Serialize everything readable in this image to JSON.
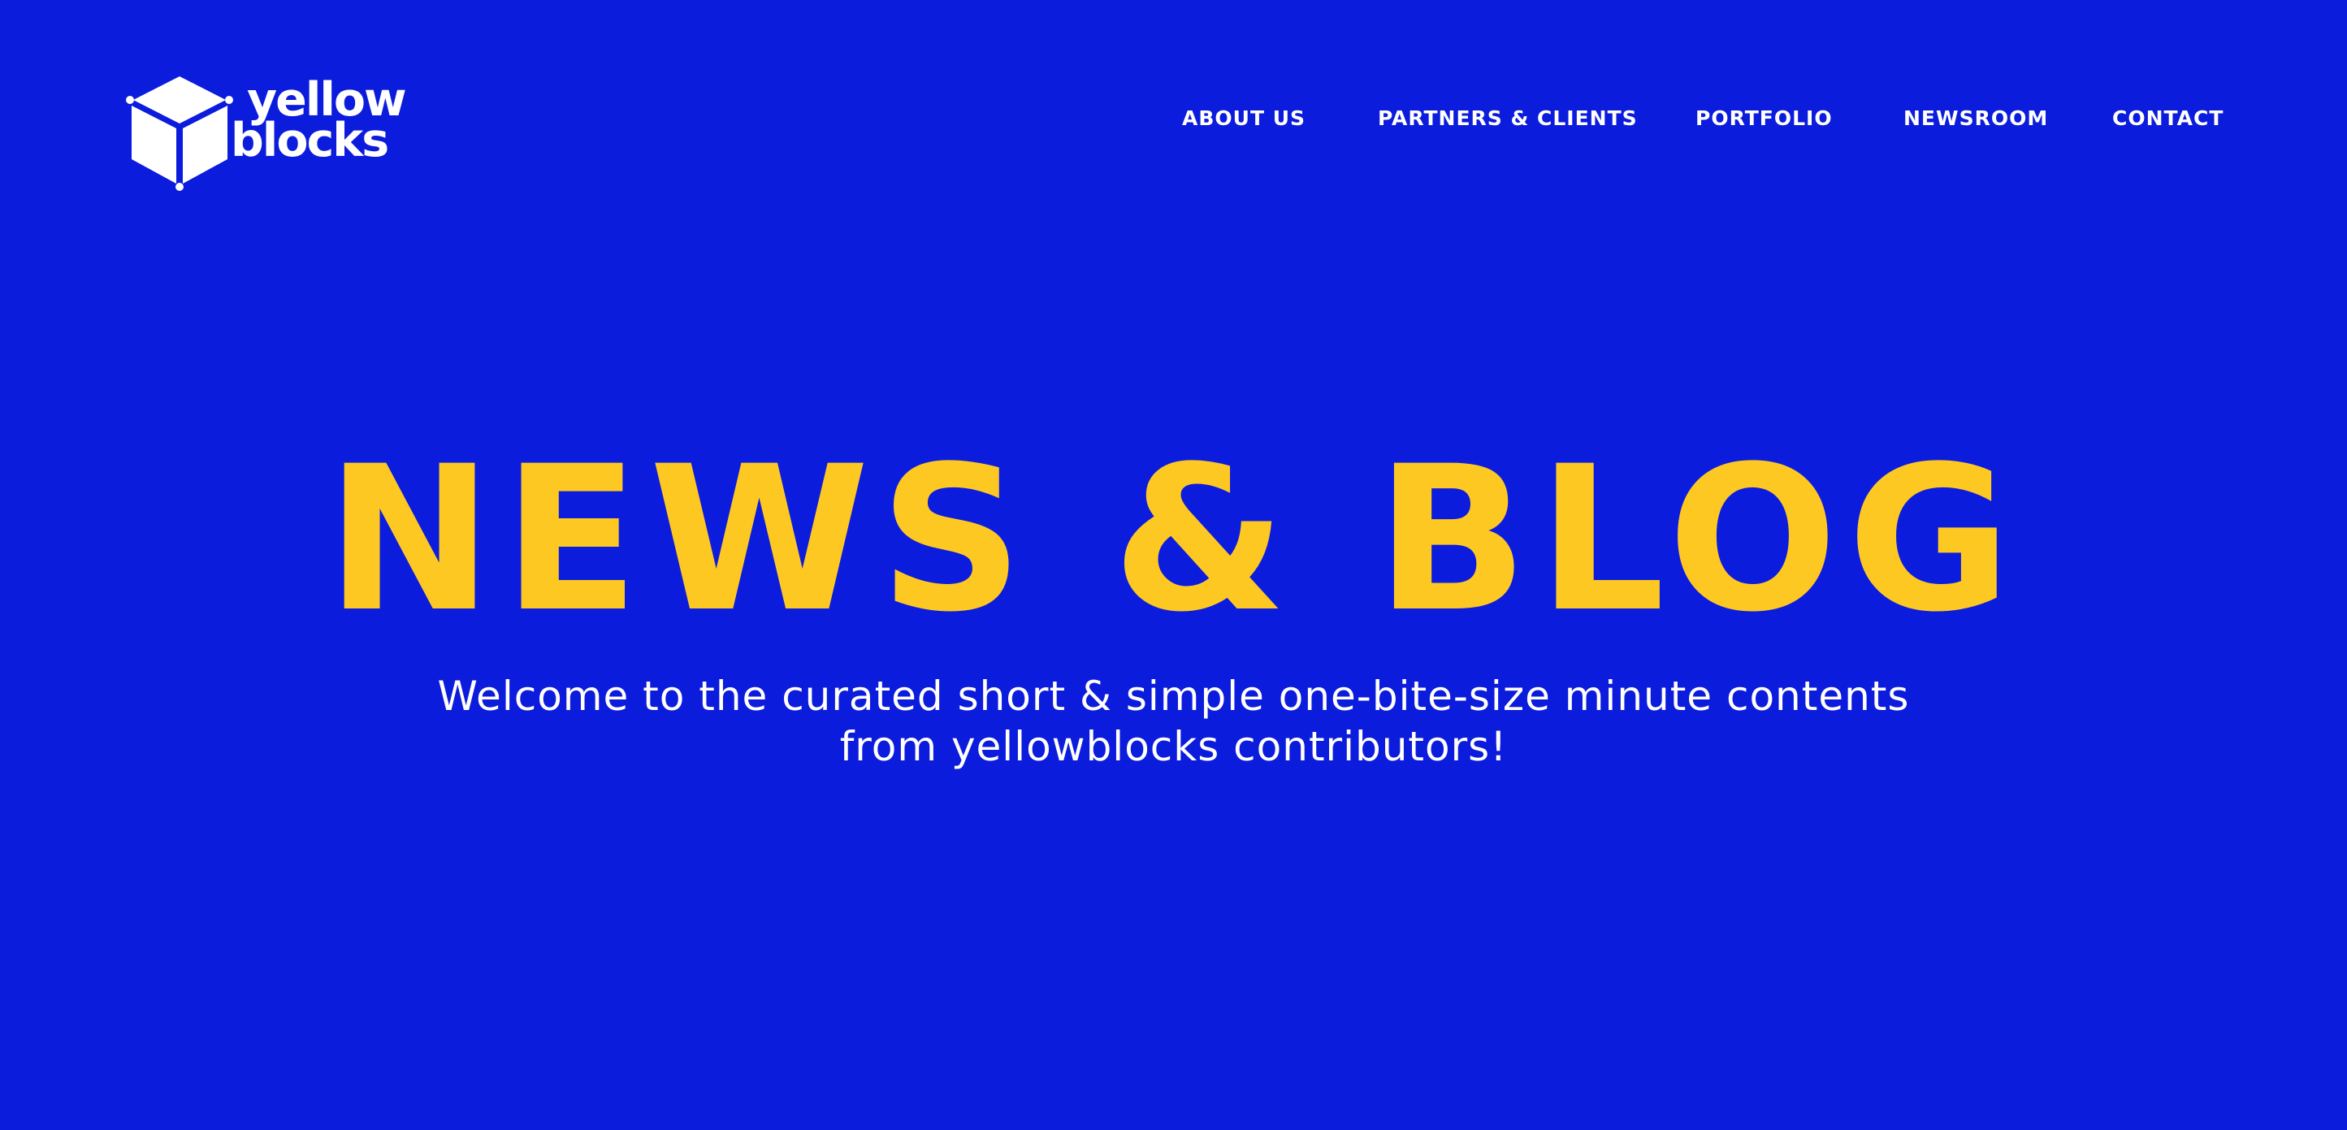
{
  "brand": {
    "logo_line1": "yellow",
    "logo_line2": "blocks",
    "icon": "cube-icon"
  },
  "nav": {
    "items": [
      {
        "label": "ABOUT US"
      },
      {
        "label": "PARTNERS & CLIENTS"
      },
      {
        "label": "PORTFOLIO"
      },
      {
        "label": "NEWSROOM"
      },
      {
        "label": "CONTACT"
      }
    ]
  },
  "hero": {
    "title": "NEWS & BLOG",
    "subtitle_line1": "Welcome to the curated short & simple one-bite-size minute contents",
    "subtitle_line2": "from yellowblocks contributors!"
  },
  "colors": {
    "background": "#0c1cdc",
    "accent": "#fec823",
    "text": "#ffffff"
  }
}
